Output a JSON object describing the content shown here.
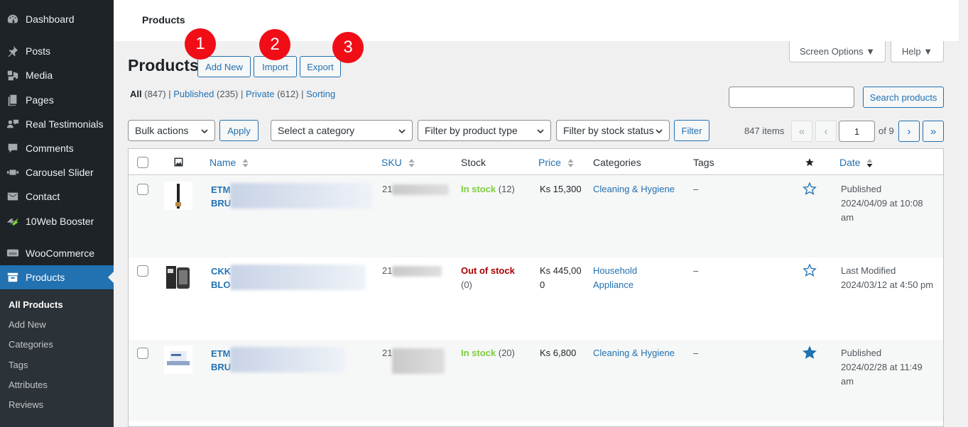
{
  "sidebar": {
    "items": [
      {
        "label": "Dashboard",
        "icon": "dashboard-icon"
      },
      {
        "label": "Posts",
        "icon": "pin-icon"
      },
      {
        "label": "Media",
        "icon": "media-icon"
      },
      {
        "label": "Pages",
        "icon": "pages-icon"
      },
      {
        "label": "Real Testimonials",
        "icon": "testimonials-icon"
      },
      {
        "label": "Comments",
        "icon": "comment-icon"
      },
      {
        "label": "Carousel Slider",
        "icon": "slider-icon"
      },
      {
        "label": "Contact",
        "icon": "mail-icon"
      },
      {
        "label": "10Web Booster",
        "icon": "booster-icon"
      },
      {
        "label": "WooCommerce",
        "icon": "woo-icon"
      },
      {
        "label": "Products",
        "icon": "archive-icon"
      }
    ],
    "submenu": [
      "All Products",
      "Add New",
      "Categories",
      "Tags",
      "Attributes",
      "Reviews"
    ]
  },
  "header": {
    "title": "Products",
    "screen_options": "Screen Options ▼",
    "help": "Help ▼"
  },
  "page": {
    "title": "Products",
    "add_new": "Add New",
    "import": "Import",
    "export": "Export",
    "badges": [
      "1",
      "2",
      "3"
    ],
    "badge_color": "#f00d16"
  },
  "filters_top": {
    "all": "All",
    "all_count": "(847)",
    "published": "Published",
    "published_count": "(235)",
    "private": "Private",
    "private_count": "(612)",
    "sorting": "Sorting",
    "sep": "|",
    "search_value": "",
    "search_button": "Search products"
  },
  "tablenav": {
    "bulk_actions": "Bulk actions",
    "apply": "Apply",
    "category": "Select a category",
    "product_type": "Filter by product type",
    "stock_status": "Filter by stock status",
    "filter": "Filter",
    "items_count": "847 items",
    "first": "«",
    "prev": "‹",
    "current_page": "1",
    "of_pages": "of 9",
    "next": "›",
    "last": "»"
  },
  "table": {
    "columns": {
      "name": "Name",
      "sku": "SKU",
      "stock": "Stock",
      "price": "Price",
      "categories": "Categories",
      "tags": "Tags",
      "date": "Date"
    },
    "rows": [
      {
        "name_l1": "ETM",
        "name_l2": "BRU",
        "sku": "21",
        "stock_status": "In stock",
        "stock_count": "(12)",
        "price_l1": "Ks 15,300",
        "price_l2": "",
        "cat_l1": "Cleaning & Hygiene",
        "cat_l2": "",
        "tags": "–",
        "featured": false,
        "date_status": "Published",
        "date_l1": "2024/04/09 at 10:08",
        "date_l2": "am"
      },
      {
        "name_l1": "CKK",
        "name_l2": "BLO",
        "sku": "21",
        "stock_status": "Out of stock",
        "stock_count": "(0)",
        "price_l1": "Ks 445,00",
        "price_l2": "0",
        "cat_l1": "Household",
        "cat_l2": "Appliance",
        "tags": "–",
        "featured": false,
        "date_status": "Last Modified",
        "date_l1": "2024/03/12 at 4:50 pm",
        "date_l2": ""
      },
      {
        "name_l1": "ETM",
        "name_l2": "BRU",
        "sku": "21",
        "stock_status": "In stock",
        "stock_count": "(20)",
        "price_l1": "Ks 6,800",
        "price_l2": "",
        "cat_l1": "Cleaning & Hygiene",
        "cat_l2": "",
        "tags": "–",
        "featured": true,
        "date_status": "Published",
        "date_l1": "2024/02/28 at 11:49",
        "date_l2": "am"
      }
    ]
  }
}
